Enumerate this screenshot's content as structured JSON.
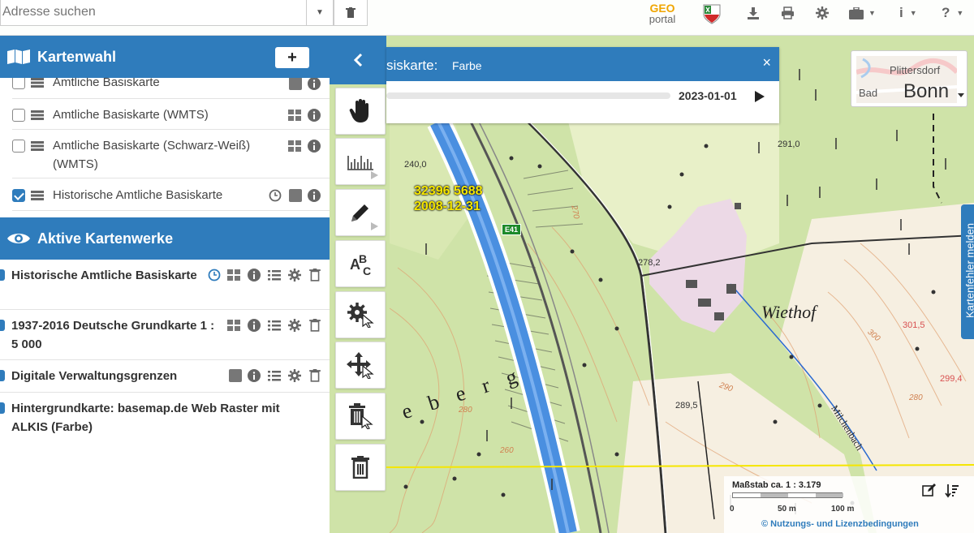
{
  "search": {
    "placeholder": "Adresse suchen"
  },
  "header": {
    "logo_geo": "GEO",
    "logo_portal": "portal",
    "info_label": "i",
    "help_label": "?"
  },
  "kartenwahl": {
    "title": "Kartenwahl",
    "add_label": "+",
    "items": [
      {
        "label": "Amtliche Basiskarte",
        "checked": false
      },
      {
        "label": "Amtliche Basiskarte (WMTS)",
        "checked": false
      },
      {
        "label": "Amtliche Basiskarte (Schwarz-Weiß) (WMTS)",
        "checked": false
      },
      {
        "label": "Historische Amtliche Basiskarte",
        "checked": true
      }
    ]
  },
  "aktive": {
    "title": "Aktive Kartenwerke",
    "items": [
      {
        "label": "Historische Amtliche Basiskarte"
      },
      {
        "label": "1937-2016 Deutsche Grundkarte 1 : 5 000"
      },
      {
        "label": "Digitale Verwaltungsgrenzen"
      },
      {
        "label": "Hintergrundkarte: basemap.de Web Raster mit ALKIS (Farbe)"
      }
    ]
  },
  "timeslider": {
    "title": "siskarte:",
    "subtitle": "Farbe",
    "date": "2023-01-01",
    "close_label": "×"
  },
  "basemap": {
    "place1": "Plittersdorf",
    "place2": "Bonn",
    "place3": "Bad"
  },
  "feedback": {
    "label": "Kartenfehler melden"
  },
  "scale": {
    "title": "Maßstab ca. 1 : 3.179",
    "tick0": "0",
    "tick50": "50 m",
    "tick100": "100 m",
    "license": "© Nutzungs- und Lizenzbedingungen"
  },
  "map_labels": {
    "coord1": "32396 5688",
    "coord2": "2008-12-31",
    "road": "E41",
    "wiethof": "Wiethof",
    "milchenbach": "Milchenbach",
    "berg": "e b e r g",
    "h2910": "291,0",
    "h2400": "240,0",
    "h2782": "278,2",
    "h2895": "289,5",
    "h3015": "301,5",
    "h2994": "299,4",
    "h280": "280",
    "h260": "260",
    "h270": "270",
    "h300": "300",
    "h290": "290",
    "h280b": "280"
  },
  "colors": {
    "accent": "#2f7cbc",
    "forest": "#cfe3a8",
    "highway": "#4a8fe0",
    "yellow_line": "#f5e600"
  }
}
